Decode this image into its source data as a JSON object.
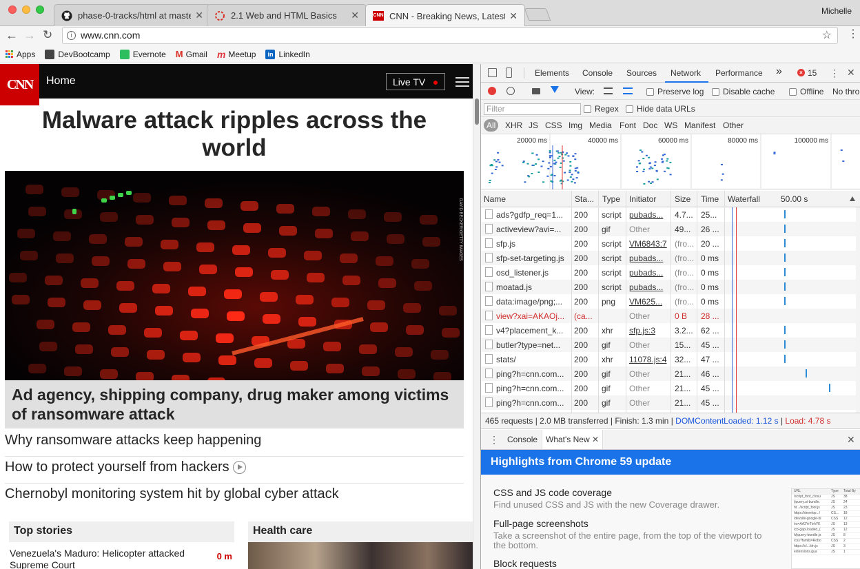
{
  "browser": {
    "tabs": [
      {
        "label": "phase-0-tracks/html at master",
        "icon": "github-icon"
      },
      {
        "label": "2.1 Web and HTML Basics",
        "icon": "loading-icon"
      },
      {
        "label": "CNN - Breaking News, Latest N",
        "icon": "cnn-icon"
      }
    ],
    "profile": "Michelle",
    "url": "www.cnn.com",
    "bookmarks": [
      {
        "label": "Apps",
        "color": "#e53935"
      },
      {
        "label": "DevBootcamp",
        "color": "#444444"
      },
      {
        "label": "Evernote",
        "color": "#2dbe60"
      },
      {
        "label": "Gmail",
        "color": "#d93025"
      },
      {
        "label": "Meetup",
        "color": "#e0393e"
      },
      {
        "label": "LinkedIn",
        "color": "#0a66c2"
      }
    ]
  },
  "cnn": {
    "logo": "CNN",
    "home": "Home",
    "live_tv": "Live TV",
    "headline": "Malware attack ripples across the world",
    "hero_credit": "DAVID BECKER/GETTY IMAGES",
    "caption": "Ad agency, shipping company, drug maker among victims of ransomware attack",
    "related": [
      "Why ransomware attacks keep happening",
      "How to protect yourself from hackers",
      "Chernobyl monitoring system hit by global cyber attack"
    ],
    "top_stories": {
      "header": "Top stories",
      "item": "Venezuela's Maduro: Helicopter attacked Supreme Court",
      "ago": "0 m"
    },
    "health_care": {
      "header": "Health care"
    }
  },
  "devtools": {
    "tabs": [
      "Elements",
      "Console",
      "Sources",
      "Network",
      "Performance"
    ],
    "more": "»",
    "error_count": "15",
    "controls": {
      "view_label": "View:",
      "preserve_log": "Preserve log",
      "disable_cache": "Disable cache",
      "offline": "Offline",
      "throttle": "No thro"
    },
    "filter": {
      "placeholder": "Filter",
      "regex": "Regex",
      "hide_data_urls": "Hide data URLs"
    },
    "types": [
      "All",
      "XHR",
      "JS",
      "CSS",
      "Img",
      "Media",
      "Font",
      "Doc",
      "WS",
      "Manifest",
      "Other"
    ],
    "overview_ticks": [
      "20000 ms",
      "40000 ms",
      "60000 ms",
      "80000 ms",
      "100000 ms"
    ],
    "columns": [
      "Name",
      "Sta...",
      "Type",
      "Initiator",
      "Size",
      "Time",
      "Waterfall"
    ],
    "waterfall_scale": "50.00 s",
    "requests": [
      {
        "name": "ads?gdfp_req=1...",
        "status": "200",
        "type": "script",
        "initiator": "pubads...",
        "size": "4.7...",
        "time": "25...",
        "wf": 0.45
      },
      {
        "name": "activeview?avi=...",
        "status": "200",
        "type": "gif",
        "initiator": "Other",
        "size": "49...",
        "time": "26 ...",
        "wf": 0.45
      },
      {
        "name": "sfp.js",
        "status": "200",
        "type": "script",
        "initiator": "VM6843:7",
        "size": "(fro...",
        "time": "20 ...",
        "wf": 0.45
      },
      {
        "name": "sfp-set-targeting.js",
        "status": "200",
        "type": "script",
        "initiator": "pubads...",
        "size": "(fro...",
        "time": "0 ms",
        "wf": 0.45
      },
      {
        "name": "osd_listener.js",
        "status": "200",
        "type": "script",
        "initiator": "pubads...",
        "size": "(fro...",
        "time": "0 ms",
        "wf": 0.45
      },
      {
        "name": "moatad.js",
        "status": "200",
        "type": "script",
        "initiator": "pubads...",
        "size": "(fro...",
        "time": "0 ms",
        "wf": 0.45
      },
      {
        "name": "data:image/png;...",
        "status": "200",
        "type": "png",
        "initiator": "VM625...",
        "size": "(fro...",
        "time": "0 ms",
        "wf": 0.45
      },
      {
        "name": "view?xai=AKAOj...",
        "status": "(ca...",
        "type": "",
        "initiator": "Other",
        "size": "0 B",
        "time": "28 ...",
        "failed": true
      },
      {
        "name": "v4?placement_k...",
        "status": "200",
        "type": "xhr",
        "initiator": "sfp.js:3",
        "size": "3.2...",
        "time": "62 ...",
        "wf": 0.45
      },
      {
        "name": "butler?type=net...",
        "status": "200",
        "type": "gif",
        "initiator": "Other",
        "size": "15...",
        "time": "45 ...",
        "wf": 0.45
      },
      {
        "name": "stats/",
        "status": "200",
        "type": "xhr",
        "initiator": "11078.js:4",
        "size": "32...",
        "time": "47 ...",
        "wf": 0.45
      },
      {
        "name": "ping?h=cnn.com...",
        "status": "200",
        "type": "gif",
        "initiator": "Other",
        "size": "21...",
        "time": "46 ...",
        "wf": 0.62
      },
      {
        "name": "ping?h=cnn.com...",
        "status": "200",
        "type": "gif",
        "initiator": "Other",
        "size": "21...",
        "time": "45 ...",
        "wf": 0.8
      },
      {
        "name": "ping?h=cnn.com...",
        "status": "200",
        "type": "gif",
        "initiator": "Other",
        "size": "21...",
        "time": "45 ..."
      }
    ],
    "status_bar": {
      "summary": "465 requests | 2.0 MB transferred | Finish: 1.3 min |",
      "dom": "DOMContentLoaded: 1.12 s",
      "load": "Load: 4.78 s"
    },
    "drawer": {
      "tabs": [
        "Console",
        "What's New"
      ],
      "banner": "Highlights from Chrome 59 update",
      "items": [
        {
          "title": "CSS and JS code coverage",
          "desc": "Find unused CSS and JS with the new Coverage drawer."
        },
        {
          "title": "Full-page screenshots",
          "desc": "Take a screenshot of the entire page, from the top of the viewport to the bottom."
        },
        {
          "title": "Block requests",
          "desc": ""
        }
      ],
      "thumb_header": [
        "URL",
        "Type",
        "Total By"
      ],
      "thumb_rows": [
        [
          "/script_foot_closu",
          "JS",
          "38"
        ],
        [
          "/jquery.ui-bundle.",
          "JS",
          "24"
        ],
        [
          "ht.../script_foot.js",
          "JS",
          "23"
        ],
        [
          "https://develop.../",
          "CS...",
          "18"
        ],
        [
          "/devsite-google-bl",
          "CSS",
          "12"
        ],
        [
          "/rs=AA2YrTtrhYE",
          "JS",
          "13"
        ],
        [
          "/cb-gapi.loaded_(",
          "JS",
          "12"
        ],
        [
          "h/jquery-bundle.js",
          "JS",
          "8"
        ],
        [
          "/css?family=Robo",
          "CSS",
          "2"
        ],
        [
          "https://cl.../dn.js",
          "JS",
          "3"
        ],
        [
          "extensions.gua",
          "JS",
          "1"
        ]
      ]
    }
  }
}
